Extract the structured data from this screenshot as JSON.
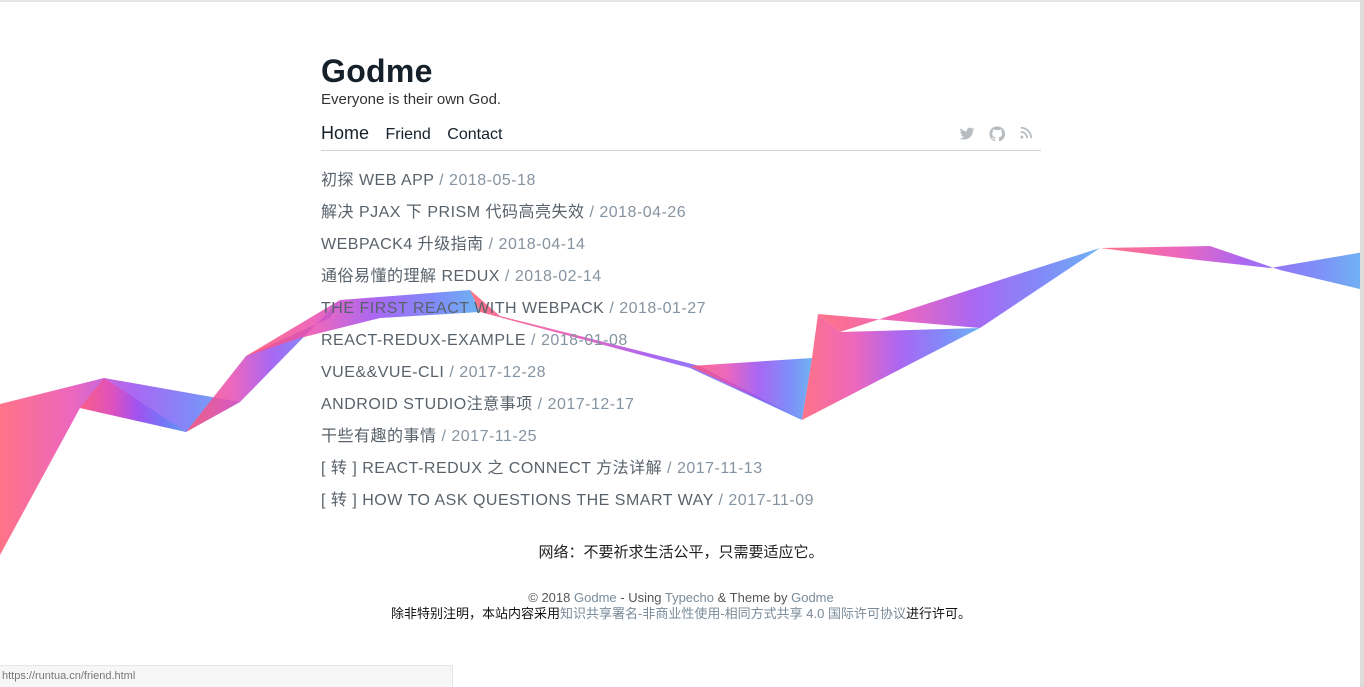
{
  "site": {
    "title": "Godme",
    "description": "Everyone is their own God."
  },
  "nav": {
    "items": [
      {
        "label": "Home"
      },
      {
        "label": "Friend"
      },
      {
        "label": "Contact"
      }
    ],
    "social": [
      "twitter-icon",
      "github-icon",
      "rss-icon"
    ]
  },
  "posts": [
    {
      "title": "初探 WEB APP",
      "date": "2018-05-18"
    },
    {
      "title": "解决 PJAX 下 PRISM 代码高亮失效",
      "date": "2018-04-26"
    },
    {
      "title": "WEBPACK4 升级指南",
      "date": "2018-04-14"
    },
    {
      "title": "通俗易懂的理解 REDUX",
      "date": "2018-02-14"
    },
    {
      "title": "THE FIRST REACT WITH WEBPACK",
      "date": "2018-01-27"
    },
    {
      "title": "REACT-REDUX-EXAMPLE",
      "date": "2018-01-08"
    },
    {
      "title": "VUE&&VUE-CLI",
      "date": "2017-12-28"
    },
    {
      "title": "ANDROID STUDIO注意事项",
      "date": "2017-12-17"
    },
    {
      "title": "干些有趣的事情",
      "date": "2017-11-25"
    },
    {
      "title": "[ 转 ] REACT-REDUX 之 CONNECT 方法详解",
      "date": "2017-11-13"
    },
    {
      "title": "[ 转 ] HOW TO ASK QUESTIONS THE SMART WAY",
      "date": "2017-11-09"
    }
  ],
  "separator": "/",
  "quote": "网络：不要祈求生活公平，只需要适应它。",
  "footer": {
    "copyright": "© 2018",
    "site_link": "Godme",
    "using_text": "- Using",
    "typecho_link": "Typecho",
    "theme_text": "& Theme by",
    "theme_link": "Godme",
    "license_pre": "除非特别注明，本站内容采用",
    "license_link": "知识共享署名-非商业性使用-相同方式共享 4.0 国际许可协议",
    "license_post": "进行许可。"
  },
  "status_bar": {
    "url": "https://runtua.cn/friend.html"
  },
  "colors": {
    "title": "#15202b",
    "post_title": "#59626b",
    "date": "#8593a1",
    "ribbon_start": "#ff3b5c",
    "ribbon_mid": "#b04cf0",
    "ribbon_end": "#4b8cf5"
  }
}
